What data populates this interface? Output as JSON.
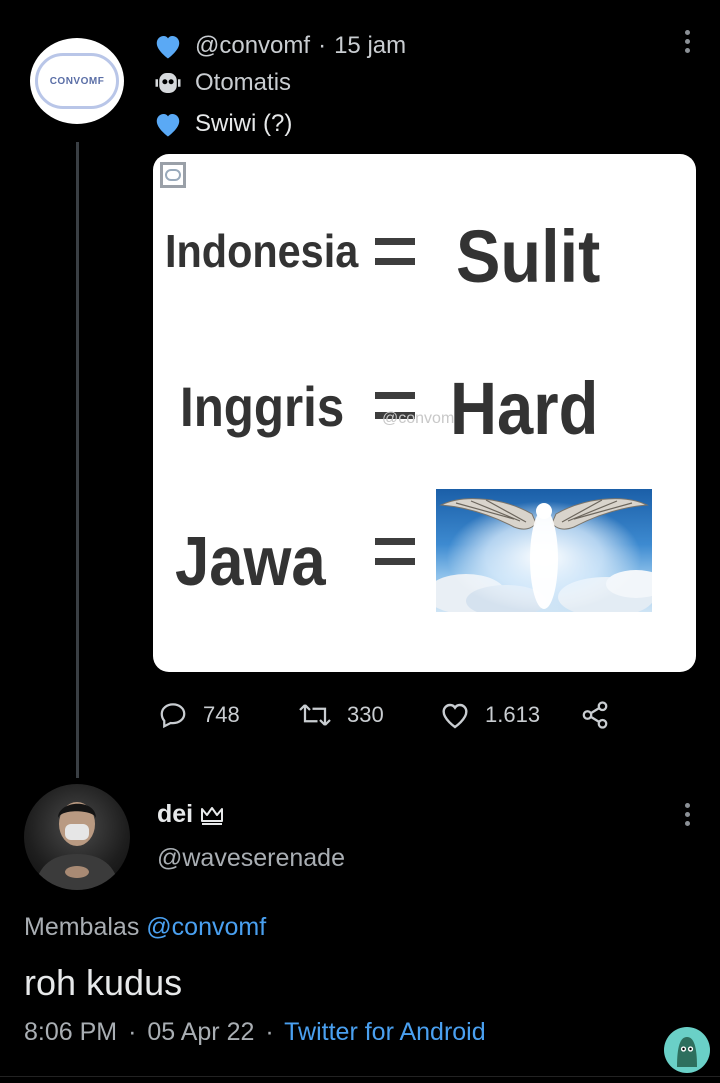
{
  "tweet": {
    "avatar_text": "CONVOMF",
    "handle": "@convomf",
    "separator": "·",
    "time": "15 jam",
    "automated_label": "Otomatis",
    "text": "Swiwi (?)",
    "image": {
      "row1_left": "Indonesia",
      "row1_right": "Sulit",
      "row2_left": "Inggris",
      "row2_right": "Hard",
      "row3_left": "Jawa",
      "watermark": "@convomf"
    },
    "actions": {
      "replies": "748",
      "retweets": "330",
      "likes": "1.613"
    }
  },
  "reply": {
    "display_name": "dei",
    "handle": "@waveserenade",
    "replying_prefix": "Membalas",
    "replying_to": "@convomf",
    "text": "roh kudus",
    "time": "8:06 PM",
    "date": "05 Apr 22",
    "source": "Twitter for Android"
  },
  "colors": {
    "background": "#000000",
    "accent_blue": "#4aa0f0",
    "heart_blue": "#5aa9f5"
  }
}
